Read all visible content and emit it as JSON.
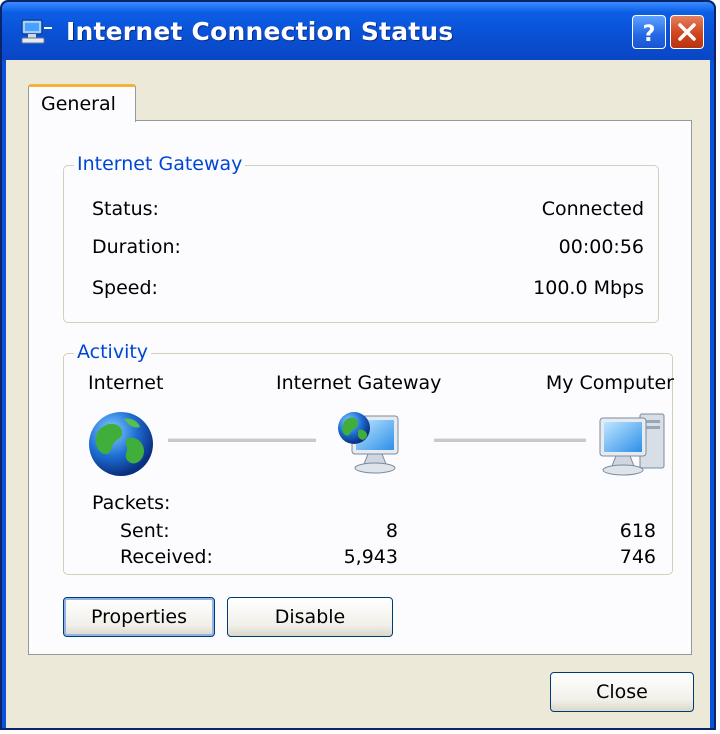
{
  "window": {
    "title": "Internet Connection Status",
    "help_button": "?",
    "close_button": "✕"
  },
  "tabs": [
    {
      "label": "General"
    }
  ],
  "internet_gateway": {
    "legend": "Internet Gateway",
    "status_label": "Status:",
    "status_value": "Connected",
    "duration_label": "Duration:",
    "duration_value": "00:00:56",
    "speed_label": "Speed:",
    "speed_value": "100.0 Mbps"
  },
  "activity": {
    "legend": "Activity",
    "nodes": [
      {
        "label": "Internet",
        "icon": "globe-icon"
      },
      {
        "label": "Internet Gateway",
        "icon": "gateway-computer-icon"
      },
      {
        "label": "My Computer",
        "icon": "computer-icon"
      }
    ],
    "packets_label": "Packets:",
    "sent_label": "Sent:",
    "received_label": "Received:",
    "gateway_sent": "8",
    "gateway_received": "5,943",
    "computer_sent": "618",
    "computer_received": "746"
  },
  "buttons": {
    "properties": "Properties",
    "disable": "Disable",
    "close": "Close"
  },
  "colors": {
    "titlebar": "#0a53d8",
    "group_legend": "#0046d5",
    "tab_highlight": "#f2b33a"
  }
}
